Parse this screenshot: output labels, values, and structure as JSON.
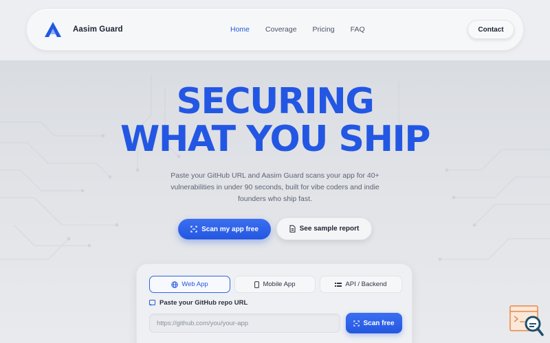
{
  "brand": {
    "name": "Aasim Guard",
    "accent": "#2356d8"
  },
  "nav": {
    "links": [
      {
        "label": "Home",
        "active": true
      },
      {
        "label": "Coverage",
        "active": false
      },
      {
        "label": "Pricing",
        "active": false
      },
      {
        "label": "FAQ",
        "active": false
      }
    ],
    "contact_label": "Contact"
  },
  "hero": {
    "line1": "SECURING",
    "line2": "WHAT YOU SHIP",
    "subtitle": "Paste your GitHub URL and Aasim Guard scans your app for 40+ vulnerabilities in under 90 seconds, built for vibe coders and indie founders who ship fast.",
    "primary_cta": "Scan my app free",
    "secondary_cta": "See sample report"
  },
  "scanner": {
    "tabs": [
      {
        "label": "Web App",
        "icon": "globe-icon",
        "active": true
      },
      {
        "label": "Mobile App",
        "icon": "phone-icon",
        "active": false
      },
      {
        "label": "API / Backend",
        "icon": "api-icon",
        "active": false
      }
    ],
    "repo_label": "Paste your GitHub repo URL",
    "repo_placeholder": "https://github.com/you/your-app",
    "scan_button": "Scan free"
  }
}
